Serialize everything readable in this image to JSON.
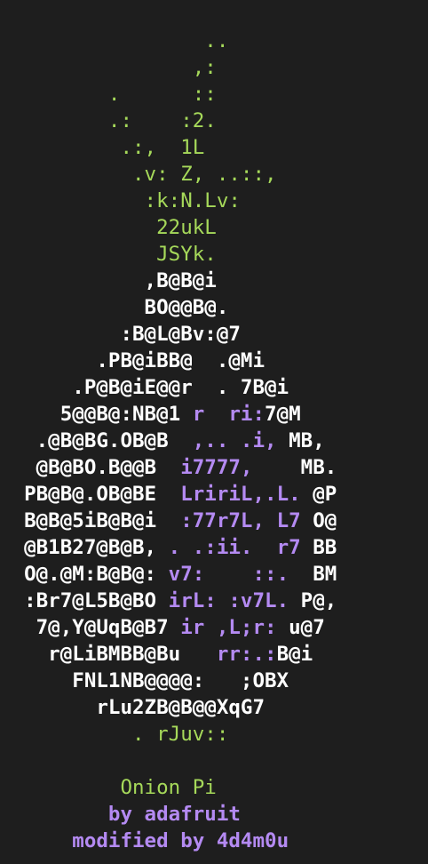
{
  "colors": {
    "background": "#1e1e1e",
    "green": "#a6d95a",
    "white": "#ffffff",
    "purple": "#b48af2"
  },
  "art": [
    [
      {
        "t": "                 ..",
        "c": "g"
      }
    ],
    [
      {
        "t": "                ,:",
        "c": "g"
      }
    ],
    [
      {
        "t": "         .      ::",
        "c": "g"
      }
    ],
    [
      {
        "t": "         .:    :2.",
        "c": "g"
      }
    ],
    [
      {
        "t": "          .:,  1L",
        "c": "g"
      }
    ],
    [
      {
        "t": "           .v: Z, ..::,",
        "c": "g"
      }
    ],
    [
      {
        "t": "            :k:N.Lv:",
        "c": "g"
      }
    ],
    [
      {
        "t": "             22ukL",
        "c": "g"
      }
    ],
    [
      {
        "t": "             JSYk.",
        "c": "g"
      }
    ],
    [
      {
        "t": "            ,B@B@i",
        "c": "w"
      }
    ],
    [
      {
        "t": "            BO@@B@.",
        "c": "w"
      }
    ],
    [
      {
        "t": "          :B@L@Bv:@7",
        "c": "w"
      }
    ],
    [
      {
        "t": "        .PB@iBB@  .@Mi",
        "c": "w"
      }
    ],
    [
      {
        "t": "      .P@B@iE@@r  . 7B@i",
        "c": "w"
      }
    ],
    [
      {
        "t": "     5@@B@:NB@1 ",
        "c": "w"
      },
      {
        "t": "r  ri:",
        "c": "p"
      },
      {
        "t": "7@M",
        "c": "w"
      }
    ],
    [
      {
        "t": "   .@B@BG.OB@B  ",
        "c": "w"
      },
      {
        "t": ",.. .i,",
        "c": "p"
      },
      {
        "t": " MB,",
        "c": "w"
      }
    ],
    [
      {
        "t": "   @B@BO.B@@B  ",
        "c": "w"
      },
      {
        "t": "i7777,",
        "c": "p"
      },
      {
        "t": "    MB.",
        "c": "w"
      }
    ],
    [
      {
        "t": "  PB@B@.OB@BE  ",
        "c": "w"
      },
      {
        "t": "LririL,.L.",
        "c": "p"
      },
      {
        "t": " @P",
        "c": "w"
      }
    ],
    [
      {
        "t": "  B@B@5iB@B@i  ",
        "c": "w"
      },
      {
        "t": ":77r7L, L7",
        "c": "p"
      },
      {
        "t": " O@",
        "c": "w"
      }
    ],
    [
      {
        "t": "  @B1B27@B@B, ",
        "c": "w"
      },
      {
        "t": ". .:ii.  r7",
        "c": "p"
      },
      {
        "t": " BB",
        "c": "w"
      }
    ],
    [
      {
        "t": "  O@.@M:B@B@: ",
        "c": "w"
      },
      {
        "t": "v7:    ::.",
        "c": "p"
      },
      {
        "t": "  BM",
        "c": "w"
      }
    ],
    [
      {
        "t": "  :Br7@L5B@BO ",
        "c": "w"
      },
      {
        "t": "irL: :v7L.",
        "c": "p"
      },
      {
        "t": " P@,",
        "c": "w"
      }
    ],
    [
      {
        "t": "   7@,Y@UqB@B7 ",
        "c": "w"
      },
      {
        "t": "ir ,L;r:",
        "c": "p"
      },
      {
        "t": " u@7",
        "c": "w"
      }
    ],
    [
      {
        "t": "    r@LiBMBB@Bu   ",
        "c": "w"
      },
      {
        "t": "rr:.:",
        "c": "p"
      },
      {
        "t": "B@i",
        "c": "w"
      }
    ],
    [
      {
        "t": "      FNL1NB@@@@:   ;OBX",
        "c": "w"
      }
    ],
    [
      {
        "t": "        rLu2ZB@B@@XqG7",
        "c": "w"
      }
    ],
    [
      {
        "t": "           . rJuv::",
        "c": "g"
      }
    ],
    [
      {
        "t": "",
        "c": "g"
      }
    ]
  ],
  "credits": {
    "title": "Onion Pi",
    "by": "by adafruit",
    "modified": "modified by 4d4m0u"
  }
}
